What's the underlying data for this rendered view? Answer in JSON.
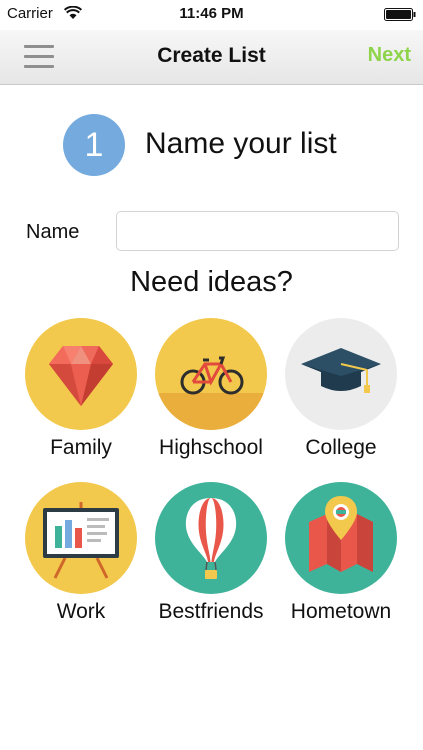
{
  "status_bar": {
    "carrier": "Carrier",
    "time": "11:46 PM"
  },
  "nav": {
    "title": "Create List",
    "next_label": "Next",
    "menu_icon": "hamburger-menu-icon"
  },
  "step": {
    "number": "1",
    "title": "Name your list"
  },
  "name_field": {
    "label": "Name",
    "value": "",
    "placeholder": ""
  },
  "ideas": {
    "title": "Need ideas?",
    "items": [
      {
        "label": "Family",
        "icon": "ruby-gem-icon"
      },
      {
        "label": "Highschool",
        "icon": "bicycle-icon"
      },
      {
        "label": "College",
        "icon": "graduation-cap-icon"
      },
      {
        "label": "Work",
        "icon": "presentation-board-icon"
      },
      {
        "label": "Bestfriends",
        "icon": "hot-air-balloon-icon"
      },
      {
        "label": "Hometown",
        "icon": "map-pin-icon"
      }
    ]
  },
  "colors": {
    "accent_green": "#8ed44a",
    "step_blue": "#74aade",
    "idea_yellow": "#f2c94c",
    "idea_teal": "#3fb39a",
    "idea_gray": "#ececec"
  }
}
